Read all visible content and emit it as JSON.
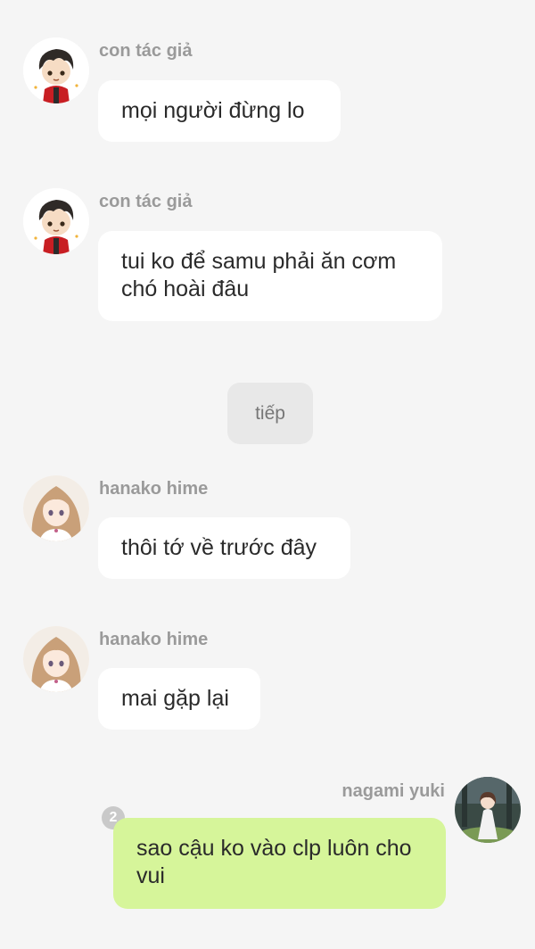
{
  "messages": [
    {
      "sender": "con tác giả",
      "text": "mọi người đừng lo"
    },
    {
      "sender": "con tác giả",
      "text": "tui ko để samu phải ăn cơm chó hoài đâu"
    },
    {
      "sender": "hanako hime",
      "text": "thôi tớ về trước đây"
    },
    {
      "sender": "hanako hime",
      "text": "mai gặp lại"
    },
    {
      "sender": "nagami yuki",
      "text": "sao cậu ko vào clp luôn cho vui",
      "read_count": "2"
    }
  ],
  "continue_label": "tiếp",
  "colors": {
    "background": "#f5f5f5",
    "other_bubble": "#ffffff",
    "my_bubble": "#d6f59a",
    "sender_name": "#9a9a9a"
  },
  "icons": {
    "author_avatar": "chibi-boy-red-jacket-avatar",
    "hanako_avatar": "anime-girl-blonde-avatar",
    "yuki_avatar": "girl-white-dress-forest-avatar"
  }
}
